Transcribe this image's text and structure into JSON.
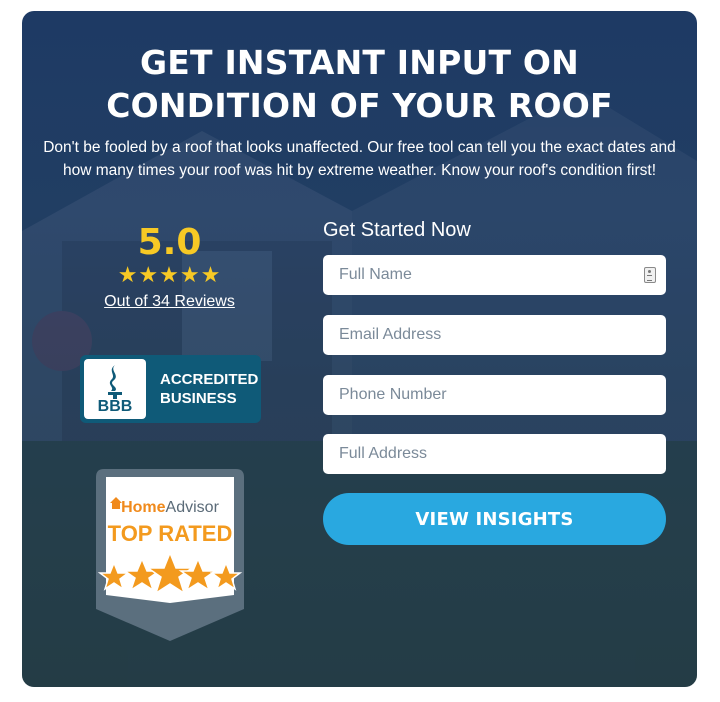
{
  "hero": {
    "title_line1": "GET INSTANT INPUT ON",
    "title_line2": "CONDITION OF YOUR ROOF",
    "subtitle": "Don't be fooled by a roof that looks unaffected. Our free tool can tell you the exact dates and how many times your roof was hit by extreme weather. Know your roof's condition first!"
  },
  "rating": {
    "score": "5.0",
    "stars": 5,
    "stars_glyphs": "★★★★★",
    "reviews_link": "Out of 34 Reviews"
  },
  "badges": {
    "bbb": {
      "mark": "BBB",
      "line1": "ACCREDITED",
      "line2": "BUSINESS",
      "color": "#0f5a78"
    },
    "homeadvisor": {
      "brand_home": "Home",
      "brand_advisor": "Advisor",
      "label": "TOP RATED",
      "stars": 5,
      "accent": "#f39a1e"
    }
  },
  "form": {
    "title": "Get Started Now",
    "fields": [
      {
        "name": "full-name",
        "placeholder": "Full Name",
        "value": ""
      },
      {
        "name": "email",
        "placeholder": "Email Address",
        "value": ""
      },
      {
        "name": "phone",
        "placeholder": "Phone Number",
        "value": ""
      },
      {
        "name": "address",
        "placeholder": "Full Address",
        "value": ""
      }
    ],
    "submit_label": "VIEW INSIGHTS",
    "submit_color": "#29a8e0"
  },
  "colors": {
    "card_bg": "#1e3a64",
    "star": "#f7c925"
  }
}
